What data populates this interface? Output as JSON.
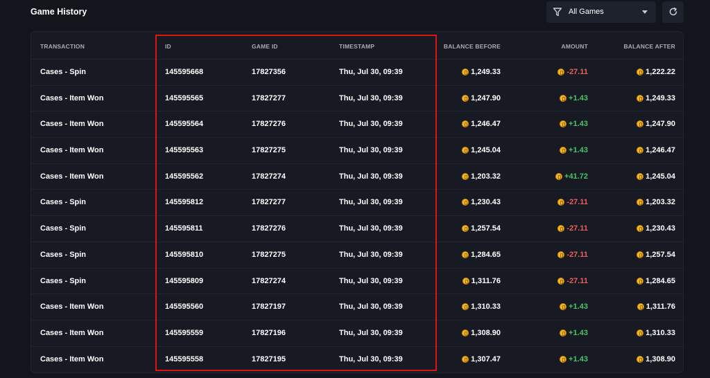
{
  "header": {
    "title": "Game History",
    "filter": {
      "selected": "All Games",
      "icon": "filter-icon"
    },
    "refresh": {
      "icon": "refresh-icon"
    }
  },
  "colors": {
    "negative": "#ee5d5d",
    "positive": "#49c467",
    "coin": "#f3b521",
    "highlight": "#e01313"
  },
  "table": {
    "columns": [
      "TRANSACTION",
      "ID",
      "GAME ID",
      "TIMESTAMP",
      "BALANCE BEFORE",
      "AMOUNT",
      "BALANCE AFTER"
    ],
    "rows": [
      {
        "transaction": "Cases - Spin",
        "id": "145595668",
        "game_id": "17827356",
        "timestamp": "Thu, Jul 30, 09:39",
        "balance_before": "1,249.33",
        "amount": "-27.11",
        "amount_sign": "neg",
        "balance_after": "1,222.22"
      },
      {
        "transaction": "Cases - Item Won",
        "id": "145595565",
        "game_id": "17827277",
        "timestamp": "Thu, Jul 30, 09:39",
        "balance_before": "1,247.90",
        "amount": "+1.43",
        "amount_sign": "pos",
        "balance_after": "1,249.33"
      },
      {
        "transaction": "Cases - Item Won",
        "id": "145595564",
        "game_id": "17827276",
        "timestamp": "Thu, Jul 30, 09:39",
        "balance_before": "1,246.47",
        "amount": "+1.43",
        "amount_sign": "pos",
        "balance_after": "1,247.90"
      },
      {
        "transaction": "Cases - Item Won",
        "id": "145595563",
        "game_id": "17827275",
        "timestamp": "Thu, Jul 30, 09:39",
        "balance_before": "1,245.04",
        "amount": "+1.43",
        "amount_sign": "pos",
        "balance_after": "1,246.47"
      },
      {
        "transaction": "Cases - Item Won",
        "id": "145595562",
        "game_id": "17827274",
        "timestamp": "Thu, Jul 30, 09:39",
        "balance_before": "1,203.32",
        "amount": "+41.72",
        "amount_sign": "pos",
        "balance_after": "1,245.04"
      },
      {
        "transaction": "Cases - Spin",
        "id": "145595812",
        "game_id": "17827277",
        "timestamp": "Thu, Jul 30, 09:39",
        "balance_before": "1,230.43",
        "amount": "-27.11",
        "amount_sign": "neg",
        "balance_after": "1,203.32"
      },
      {
        "transaction": "Cases - Spin",
        "id": "145595811",
        "game_id": "17827276",
        "timestamp": "Thu, Jul 30, 09:39",
        "balance_before": "1,257.54",
        "amount": "-27.11",
        "amount_sign": "neg",
        "balance_after": "1,230.43"
      },
      {
        "transaction": "Cases - Spin",
        "id": "145595810",
        "game_id": "17827275",
        "timestamp": "Thu, Jul 30, 09:39",
        "balance_before": "1,284.65",
        "amount": "-27.11",
        "amount_sign": "neg",
        "balance_after": "1,257.54"
      },
      {
        "transaction": "Cases - Spin",
        "id": "145595809",
        "game_id": "17827274",
        "timestamp": "Thu, Jul 30, 09:39",
        "balance_before": "1,311.76",
        "amount": "-27.11",
        "amount_sign": "neg",
        "balance_after": "1,284.65"
      },
      {
        "transaction": "Cases - Item Won",
        "id": "145595560",
        "game_id": "17827197",
        "timestamp": "Thu, Jul 30, 09:39",
        "balance_before": "1,310.33",
        "amount": "+1.43",
        "amount_sign": "pos",
        "balance_after": "1,311.76"
      },
      {
        "transaction": "Cases - Item Won",
        "id": "145595559",
        "game_id": "17827196",
        "timestamp": "Thu, Jul 30, 09:39",
        "balance_before": "1,308.90",
        "amount": "+1.43",
        "amount_sign": "pos",
        "balance_after": "1,310.33"
      },
      {
        "transaction": "Cases - Item Won",
        "id": "145595558",
        "game_id": "17827195",
        "timestamp": "Thu, Jul 30, 09:39",
        "balance_before": "1,307.47",
        "amount": "+1.43",
        "amount_sign": "pos",
        "balance_after": "1,308.90"
      }
    ]
  }
}
